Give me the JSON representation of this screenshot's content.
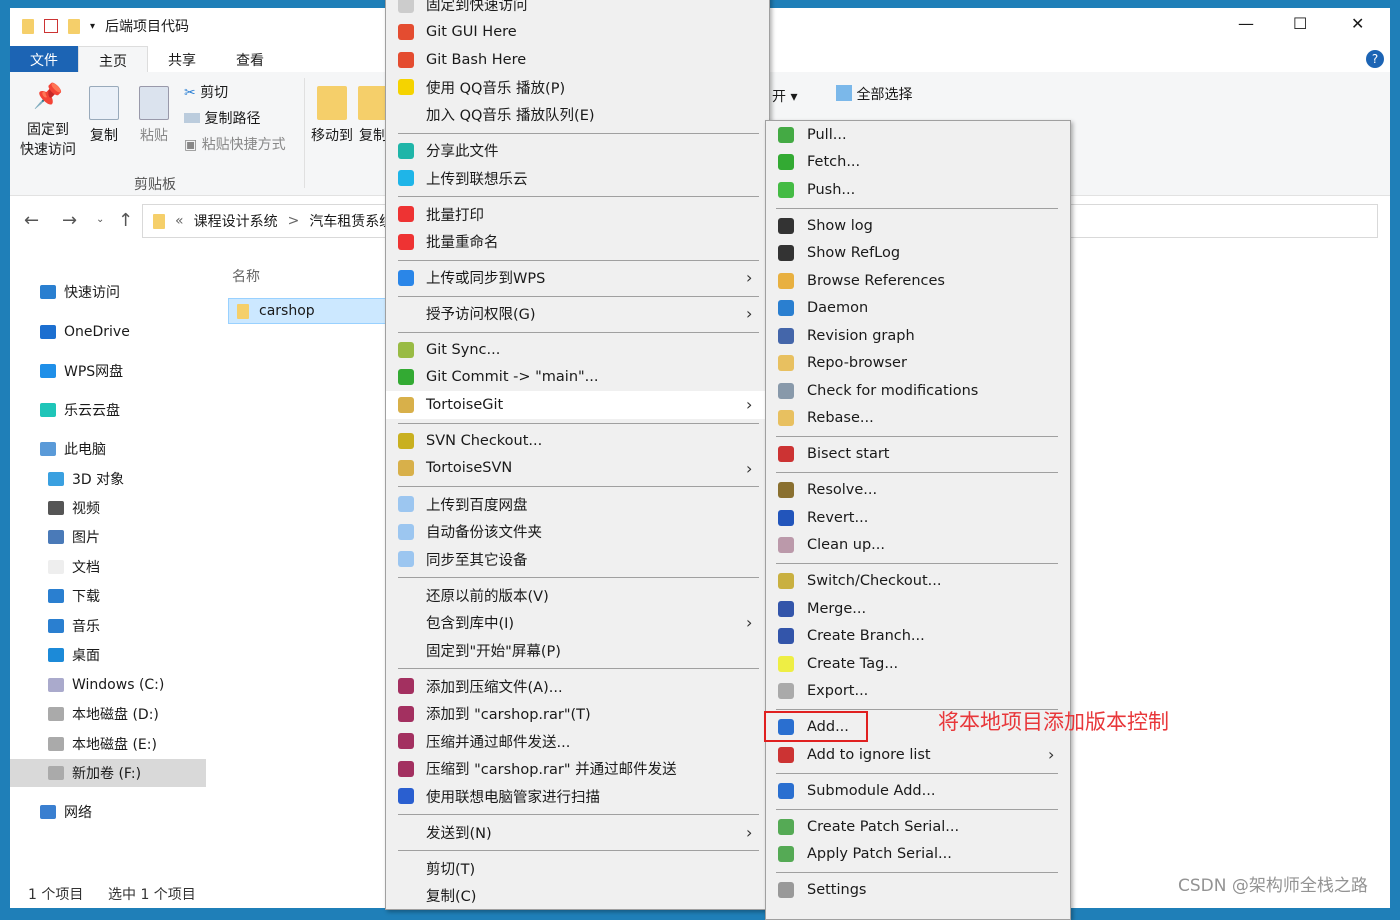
{
  "window": {
    "title": "后端项目代码",
    "tabs": [
      "文件",
      "主页",
      "共享",
      "查看"
    ],
    "controls": {
      "minimize": "—",
      "maximize": "☐",
      "close": "✕",
      "help": "?"
    }
  },
  "ribbon": {
    "pin": "固定到\n快速访问",
    "copy": "复制",
    "paste": "粘贴",
    "cut": "剪切",
    "copy_path": "复制路径",
    "paste_shortcut": "粘贴快捷方式",
    "group_clipboard": "剪贴板",
    "move_to": "移动到",
    "copy_to": "复制",
    "open": "开 ▾",
    "select_all": "全部选择"
  },
  "address": {
    "crumbs": [
      "«",
      "课程设计系统",
      ">",
      "汽车租赁系统"
    ]
  },
  "nav": [
    "快速访问",
    "OneDrive",
    "WPS网盘",
    "乐云云盘",
    "此电脑",
    "3D 对象",
    "视频",
    "图片",
    "文档",
    "下载",
    "音乐",
    "桌面",
    "Windows (C:)",
    "本地磁盘 (D:)",
    "本地磁盘 (E:)",
    "新加卷 (F:)",
    "网络"
  ],
  "files": {
    "header": "名称",
    "items": [
      "carshop"
    ]
  },
  "status": {
    "count": "1 个项目",
    "selected": "选中 1 个项目"
  },
  "context_menu": [
    {
      "label": "固定到快速访问",
      "icon": "pin-icon"
    },
    {
      "label": "Git GUI Here",
      "icon": "git-icon"
    },
    {
      "label": "Git Bash Here",
      "icon": "git-icon"
    },
    {
      "label": "使用 QQ音乐 播放(P)",
      "icon": "qqmusic-icon"
    },
    {
      "label": "加入 QQ音乐 播放队列(E)"
    },
    {
      "sep": true
    },
    {
      "label": "分享此文件",
      "icon": "share-icon"
    },
    {
      "label": "上传到联想乐云",
      "icon": "cloud-icon"
    },
    {
      "sep": true
    },
    {
      "label": "批量打印",
      "icon": "wps-icon"
    },
    {
      "label": "批量重命名",
      "icon": "wps-icon"
    },
    {
      "sep": true
    },
    {
      "label": "上传或同步到WPS",
      "icon": "upload-icon",
      "sub": true
    },
    {
      "sep": true
    },
    {
      "label": "授予访问权限(G)",
      "sub": true
    },
    {
      "sep": true
    },
    {
      "label": "Git Sync...",
      "icon": "git-sync-icon"
    },
    {
      "label": "Git Commit -> \"main\"...",
      "icon": "git-commit-icon"
    },
    {
      "label": "TortoiseGit",
      "icon": "tortoisegit-icon",
      "sub": true,
      "highlight": true
    },
    {
      "sep": true
    },
    {
      "label": "SVN Checkout...",
      "icon": "svn-icon"
    },
    {
      "label": "TortoiseSVN",
      "icon": "tortoisesvn-icon",
      "sub": true
    },
    {
      "sep": true
    },
    {
      "label": "上传到百度网盘",
      "icon": "baidu-icon"
    },
    {
      "label": "自动备份该文件夹",
      "icon": "baidu-icon"
    },
    {
      "label": "同步至其它设备",
      "icon": "baidu-icon"
    },
    {
      "sep": true
    },
    {
      "label": "还原以前的版本(V)"
    },
    {
      "label": "包含到库中(I)",
      "sub": true
    },
    {
      "label": "固定到\"开始\"屏幕(P)"
    },
    {
      "sep": true
    },
    {
      "label": "添加到压缩文件(A)...",
      "icon": "winrar-icon"
    },
    {
      "label": "添加到 \"carshop.rar\"(T)",
      "icon": "winrar-icon"
    },
    {
      "label": "压缩并通过邮件发送...",
      "icon": "winrar-icon"
    },
    {
      "label": "压缩到 \"carshop.rar\" 并通过邮件发送",
      "icon": "winrar-icon"
    },
    {
      "label": "使用联想电脑管家进行扫描",
      "icon": "shield-icon"
    },
    {
      "sep": true
    },
    {
      "label": "发送到(N)",
      "sub": true
    },
    {
      "sep": true
    },
    {
      "label": "剪切(T)"
    },
    {
      "label": "复制(C)"
    }
  ],
  "submenu": [
    {
      "label": "Pull...",
      "icon": "pull-icon"
    },
    {
      "label": "Fetch...",
      "icon": "fetch-icon"
    },
    {
      "label": "Push...",
      "icon": "push-icon"
    },
    {
      "sep": true
    },
    {
      "label": "Show log",
      "icon": "log-icon"
    },
    {
      "label": "Show RefLog",
      "icon": "log-icon"
    },
    {
      "label": "Browse References",
      "icon": "references-icon"
    },
    {
      "label": "Daemon",
      "icon": "globe-icon"
    },
    {
      "label": "Revision graph",
      "icon": "graph-icon"
    },
    {
      "label": "Repo-browser",
      "icon": "repo-icon"
    },
    {
      "label": "Check for modifications",
      "icon": "check-icon"
    },
    {
      "label": "Rebase...",
      "icon": "rebase-icon"
    },
    {
      "sep": true
    },
    {
      "label": "Bisect start",
      "icon": "bisect-icon"
    },
    {
      "sep": true
    },
    {
      "label": "Resolve...",
      "icon": "resolve-icon"
    },
    {
      "label": "Revert...",
      "icon": "revert-icon"
    },
    {
      "label": "Clean up...",
      "icon": "broom-icon"
    },
    {
      "sep": true
    },
    {
      "label": "Switch/Checkout...",
      "icon": "switch-icon"
    },
    {
      "label": "Merge...",
      "icon": "merge-icon"
    },
    {
      "label": "Create Branch...",
      "icon": "branch-icon"
    },
    {
      "label": "Create Tag...",
      "icon": "tag-icon"
    },
    {
      "label": "Export...",
      "icon": "export-icon"
    },
    {
      "sep": true
    },
    {
      "label": "Add...",
      "icon": "plus-icon",
      "boxed": true
    },
    {
      "label": "Add to ignore list",
      "icon": "ignore-icon",
      "sub": true
    },
    {
      "sep": true
    },
    {
      "label": "Submodule Add...",
      "icon": "plus-icon"
    },
    {
      "sep": true
    },
    {
      "label": "Create Patch Serial...",
      "icon": "patch-icon"
    },
    {
      "label": "Apply Patch Serial...",
      "icon": "patch-icon"
    },
    {
      "sep": true
    },
    {
      "label": "Settings",
      "icon": "wrench-icon"
    }
  ],
  "annotation": {
    "text": "将本地项目添加版本控制",
    "color": "#e8373a"
  },
  "watermark": "CSDN @架构师全栈之路",
  "colors": {
    "accent": "#1c64b4",
    "menu_bg": "#f0f0f0",
    "selection": "#cce8ff"
  }
}
